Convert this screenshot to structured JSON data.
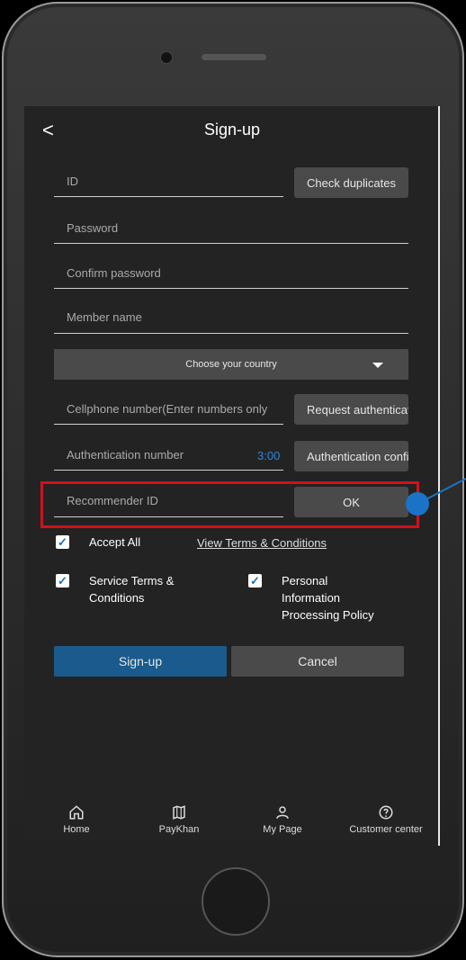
{
  "header": {
    "back_icon": "chevron-left-icon",
    "back_glyph": "<",
    "title": "Sign-up"
  },
  "form": {
    "id_placeholder": "ID",
    "check_duplicates_label": "Check duplicates",
    "password_placeholder": "Password",
    "confirm_password_placeholder": "Confirm password",
    "member_name_placeholder": "Member name",
    "country_select": "Choose your country",
    "cellphone_placeholder": "Cellphone number(Enter numbers only",
    "request_auth_label": "Request authentication",
    "auth_number_placeholder": "Authentication number",
    "auth_timer": "3:00",
    "auth_confirm_label": "Authentication confirme",
    "recommender_placeholder": "Recommender ID",
    "ok_label": "OK"
  },
  "terms": {
    "accept_all": "Accept All",
    "view_terms": "View Terms & Conditions",
    "service_terms_line1": "Service Terms &",
    "service_terms_line2": "Conditions",
    "privacy_line1": "Personal",
    "privacy_line2": "Information",
    "privacy_line3": "Processing Policy"
  },
  "actions": {
    "signup": "Sign-up",
    "cancel": "Cancel"
  },
  "nav": {
    "items": [
      {
        "label": "Home",
        "icon": "home-icon"
      },
      {
        "label": "PayKhan",
        "icon": "map-icon"
      },
      {
        "label": "My Page",
        "icon": "user-icon"
      },
      {
        "label": "Customer center",
        "icon": "help-circle-icon"
      }
    ]
  },
  "colors": {
    "accent": "#1a5a8c",
    "highlight": "#d0111b",
    "timer": "#2c87d6"
  }
}
